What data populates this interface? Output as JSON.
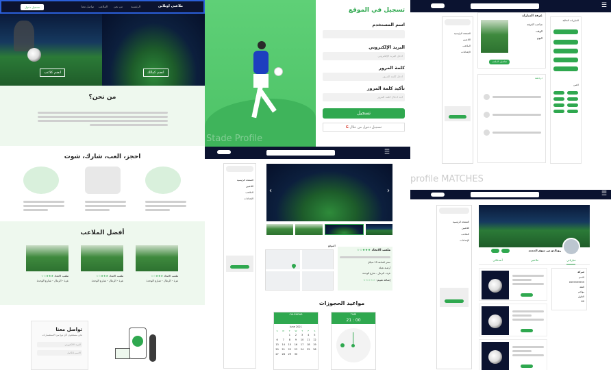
{
  "landing": {
    "nav": {
      "logo": "ملاعبي اونلاين",
      "links": [
        "الرئيسية",
        "من نحن",
        "الملاعب",
        "تواصل معنا"
      ],
      "login_button": "تسجيل دخول"
    },
    "hero": {
      "btn_join": "انضم كلاعب",
      "btn_owner": "انضم كمالك"
    },
    "about": {
      "title": "من نحن؟"
    },
    "book": {
      "title": "احجز، العب، شارك، شوت"
    },
    "best": {
      "title": "أفضل الملاعب",
      "cards": [
        {
          "name": "ملعب الاتحاد",
          "loc": "غزة - الرمال - شارع الوحدة",
          "stars": 3
        },
        {
          "name": "ملعب الاتحاد",
          "loc": "غزة - الرمال - شارع الوحدة",
          "stars": 3
        },
        {
          "name": "ملعب الاتحاد",
          "loc": "غزة - الرمال - شارع الوحدة",
          "stars": 3
        }
      ]
    },
    "contact": {
      "title": "تواصل معنا",
      "subtitle": "نحن مستعدون لأي نوع من الاستفسارات",
      "email_placeholder": "البريد الالكتروني",
      "name_placeholder": "الاسم بالكامل"
    }
  },
  "signup": {
    "title": "تسجيل في الموقع",
    "username": "اسم المستخدم",
    "email": "البريد الإلكتروني",
    "email_placeholder": "ادخل البريد الإلكتروني",
    "password": "كلمة المرور",
    "password_placeholder": "ادخل كلمة المرور",
    "confirm": "تأكيد كلمة المرور",
    "confirm_placeholder": "اعد ادخال كلمة المرور",
    "submit": "تسجيل",
    "google": "تسجيل دخول من خلال",
    "watermark": "Stade Profile"
  },
  "matches": {
    "room_title": "غرفة المباراة",
    "owner": "صاحب الغرفة",
    "time": "الوقت",
    "date": "اليوم",
    "stadium_btn": "تفاصيل الملعب",
    "chat_label": "دردشة",
    "players_label": "لاعبي",
    "section_title": "المباريات الحالية",
    "watermark_a": "profile",
    "watermark_b": "MATCHES"
  },
  "sidebar": {
    "items": [
      "الصفحة الرئيسية",
      "اللاعبين",
      "الملاعب",
      "الإعدادات"
    ]
  },
  "stadium": {
    "name": "ملعب الاتحاد",
    "price": "سعر الساعة 15 شيكل",
    "type": "أرضية نجيلة",
    "loc": "غزة - الرمال - شارع الوحدة",
    "rate": "إضافة تقييم:",
    "location_label": "الموقع",
    "bookings_title": "مواعيد الحجوزات",
    "cal_month": "June 2021",
    "cal_header_left": "CALENDAR",
    "cal_header_right": "TIME",
    "time_value": "21 : 00",
    "weekdays": [
      "S",
      "M",
      "T",
      "W",
      "T",
      "F",
      "S"
    ],
    "days": [
      "1",
      "2",
      "3",
      "4",
      "5",
      "6",
      "7",
      "8",
      "9",
      "10",
      "11",
      "12",
      "13",
      "14",
      "15",
      "16",
      "17",
      "18",
      "19",
      "20",
      "21",
      "22",
      "23",
      "24",
      "25",
      "26",
      "27",
      "28",
      "29",
      "30"
    ]
  },
  "profile": {
    "name": "روبالدو من سوق الجمعة",
    "tabs": [
      "مبارياتي",
      "ملاعبي",
      "أصدقائي"
    ],
    "info_title": "شركة",
    "info_rows": [
      "الاسم",
      "0599999999",
      "الفئة",
      "مهاجم",
      "الطول",
      "60"
    ]
  }
}
